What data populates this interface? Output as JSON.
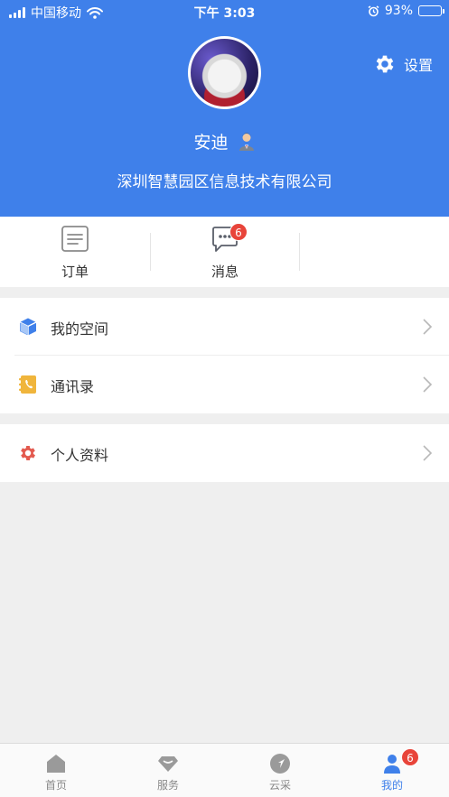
{
  "status_bar": {
    "carrier": "中国移动",
    "time": "下午 3:03",
    "battery_percent": "93%",
    "battery_level": 0.93
  },
  "header": {
    "settings_label": "设置",
    "username": "安迪",
    "company": "深圳智慧园区信息技术有限公司",
    "background_color": "#3f80ea"
  },
  "quick_actions": [
    {
      "label": "订单",
      "icon": "order-list-icon"
    },
    {
      "label": "消息",
      "icon": "message-bubble-icon",
      "badge": "6"
    }
  ],
  "menu_groups": [
    [
      {
        "label": "我的空间",
        "icon": "cube-icon",
        "color": "#3f80ea"
      },
      {
        "label": "通讯录",
        "icon": "contacts-phone-icon",
        "color": "#f0b53c"
      }
    ],
    [
      {
        "label": "个人资料",
        "icon": "gear-icon",
        "color": "#e35a4f"
      }
    ]
  ],
  "tabbar": {
    "items": [
      {
        "label": "首页",
        "icon": "home-icon"
      },
      {
        "label": "服务",
        "icon": "diamond-icon"
      },
      {
        "label": "云采",
        "icon": "compass-icon"
      },
      {
        "label": "我的",
        "icon": "user-icon",
        "badge": "6",
        "active": true
      }
    ],
    "active_color": "#3f80ea"
  }
}
